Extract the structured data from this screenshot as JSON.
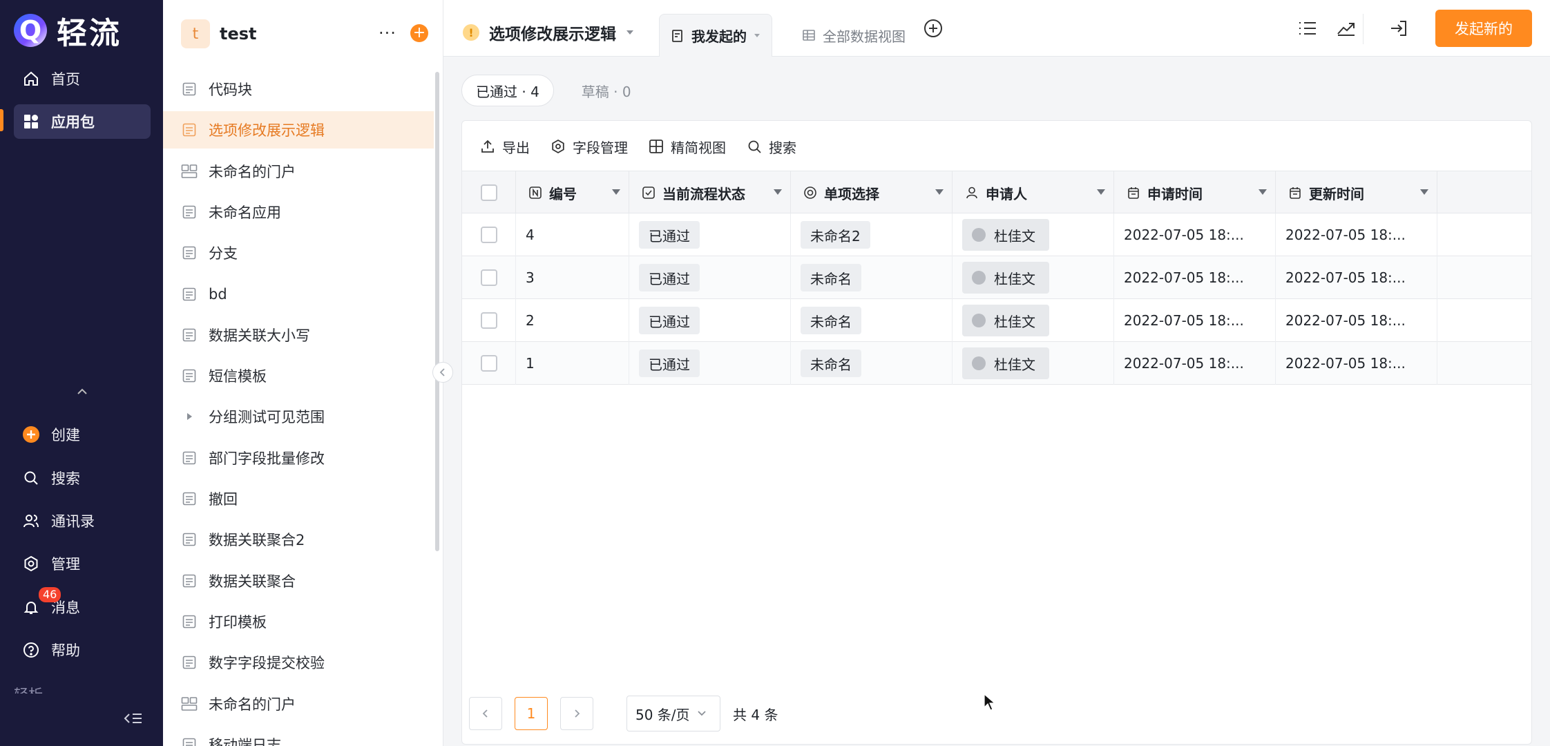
{
  "brand": {
    "name": "轻流"
  },
  "nav": {
    "items": [
      {
        "label": "首页",
        "icon": "home-icon"
      },
      {
        "label": "应用包",
        "icon": "apps-icon",
        "active": true
      },
      {
        "label": "创建",
        "icon": "plus-circle-icon"
      },
      {
        "label": "搜索",
        "icon": "search-icon"
      },
      {
        "label": "通讯录",
        "icon": "contacts-icon"
      },
      {
        "label": "管理",
        "icon": "gear-icon"
      },
      {
        "label": "消息",
        "icon": "bell-icon"
      },
      {
        "label": "帮助",
        "icon": "help-icon"
      }
    ],
    "message_badge": "46",
    "fade_text": "轻析"
  },
  "workspace": {
    "avatar": "t",
    "name": "test",
    "more": "···"
  },
  "apps": [
    {
      "label": "代码块",
      "icon": "form-icon"
    },
    {
      "label": "选项修改展示逻辑",
      "icon": "form-icon",
      "active": true
    },
    {
      "label": "未命名的门户",
      "icon": "portal-icon"
    },
    {
      "label": "未命名应用",
      "icon": "form-icon"
    },
    {
      "label": "分支",
      "icon": "form-icon"
    },
    {
      "label": "bd",
      "icon": "form-icon"
    },
    {
      "label": "数据关联大小写",
      "icon": "form-icon"
    },
    {
      "label": "短信模板",
      "icon": "form-icon"
    },
    {
      "label": "分组测试可见范围",
      "icon": "triangle-right-icon"
    },
    {
      "label": "部门字段批量修改",
      "icon": "form-icon"
    },
    {
      "label": "撤回",
      "icon": "form-icon"
    },
    {
      "label": "数据关联聚合2",
      "icon": "form-icon"
    },
    {
      "label": "数据关联聚合",
      "icon": "form-icon"
    },
    {
      "label": "打印模板",
      "icon": "form-icon"
    },
    {
      "label": "数字字段提交校验",
      "icon": "form-icon"
    },
    {
      "label": "未命名的门户",
      "icon": "portal-icon"
    },
    {
      "label": "移动端日志",
      "icon": "form-icon"
    }
  ],
  "topbar": {
    "app_title": "选项修改展示逻辑",
    "tab_active": "我发起的",
    "tab_other": "全部数据视图",
    "primary_button": "发起新的"
  },
  "status_tabs": {
    "approved": "已通过 · 4",
    "draft": "草稿 · 0"
  },
  "toolbar": {
    "export": "导出",
    "fields": "字段管理",
    "compact": "精简视图",
    "search": "搜索"
  },
  "table": {
    "columns": [
      "编号",
      "当前流程状态",
      "单项选择",
      "申请人",
      "申请时间",
      "更新时间"
    ],
    "rows": [
      {
        "id": "4",
        "status": "已通过",
        "choice": "未命名2",
        "applicant": "杜佳文",
        "created": "2022-07-05 18:...",
        "updated": "2022-07-05 18:..."
      },
      {
        "id": "3",
        "status": "已通过",
        "choice": "未命名",
        "applicant": "杜佳文",
        "created": "2022-07-05 18:...",
        "updated": "2022-07-05 18:..."
      },
      {
        "id": "2",
        "status": "已通过",
        "choice": "未命名",
        "applicant": "杜佳文",
        "created": "2022-07-05 18:...",
        "updated": "2022-07-05 18:..."
      },
      {
        "id": "1",
        "status": "已通过",
        "choice": "未命名",
        "applicant": "杜佳文",
        "created": "2022-07-05 18:...",
        "updated": "2022-07-05 18:..."
      }
    ]
  },
  "pager": {
    "current": "1",
    "page_size": "50 条/页",
    "total": "共 4 条"
  },
  "colors": {
    "accent": "#ff8a1f",
    "nav_bg": "#1a1a3a"
  }
}
